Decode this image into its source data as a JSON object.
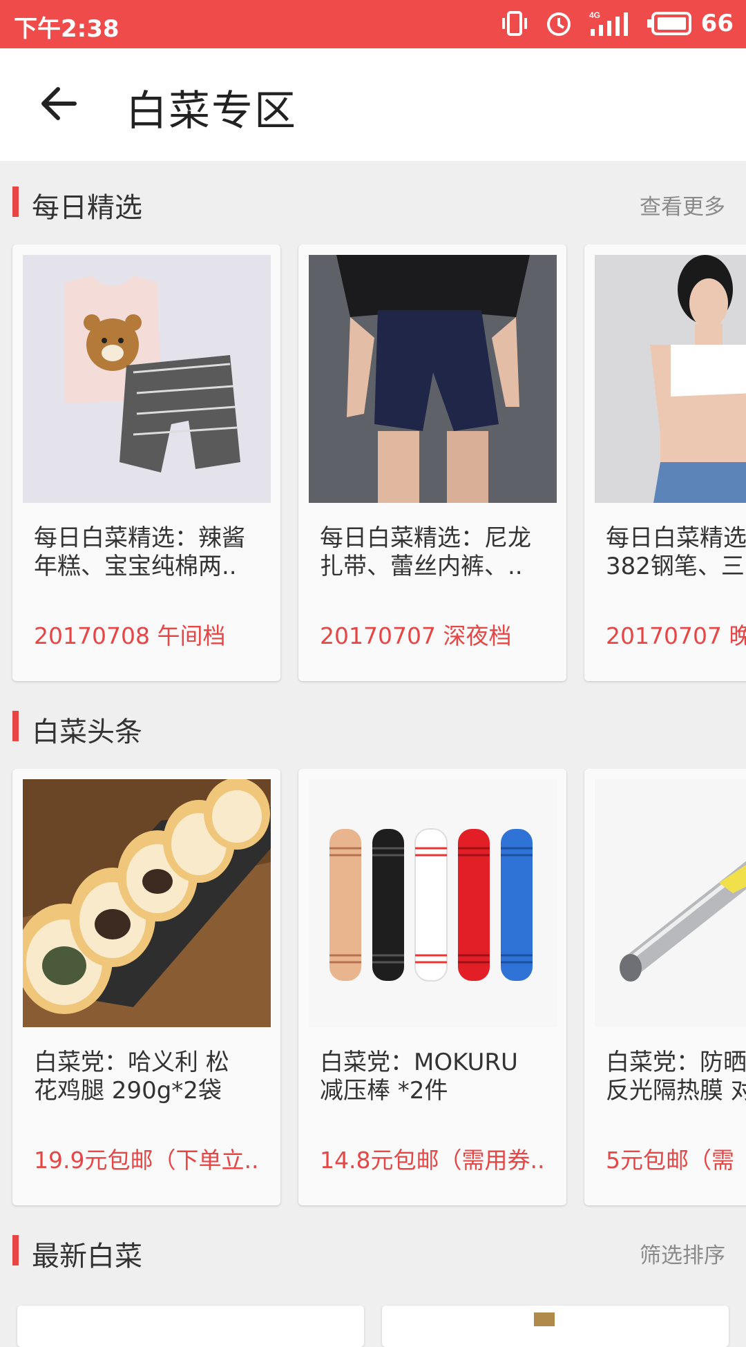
{
  "status_bar": {
    "time": "下午2:38",
    "battery": "66"
  },
  "app_bar": {
    "title": "白菜专区"
  },
  "sections": [
    {
      "title": "每日精选",
      "more": "查看更多",
      "cards": [
        {
          "title": "每日白菜精选：辣酱\n年糕、宝宝纯棉两..",
          "subtitle": "20170708 午间档"
        },
        {
          "title": "每日白菜精选：尼龙\n扎带、蕾丝内裤、..",
          "subtitle": "20170707 深夜档"
        },
        {
          "title": "每日白菜精选\n382钢笔、三",
          "subtitle": "20170707 晚"
        }
      ]
    },
    {
      "title": "白菜头条",
      "more": "",
      "cards": [
        {
          "title": "白菜党：哈义利 松\n花鸡腿 290g*2袋",
          "subtitle": "19.9元包邮（下单立.."
        },
        {
          "title": "白菜党：MOKURU\n减压棒 *2件",
          "subtitle": "14.8元包邮（需用券.."
        },
        {
          "title": "白菜党：防晒\n反光隔热膜 对",
          "subtitle": "5元包邮（需"
        }
      ]
    },
    {
      "title": "最新白菜",
      "more": "筛选排序"
    }
  ]
}
